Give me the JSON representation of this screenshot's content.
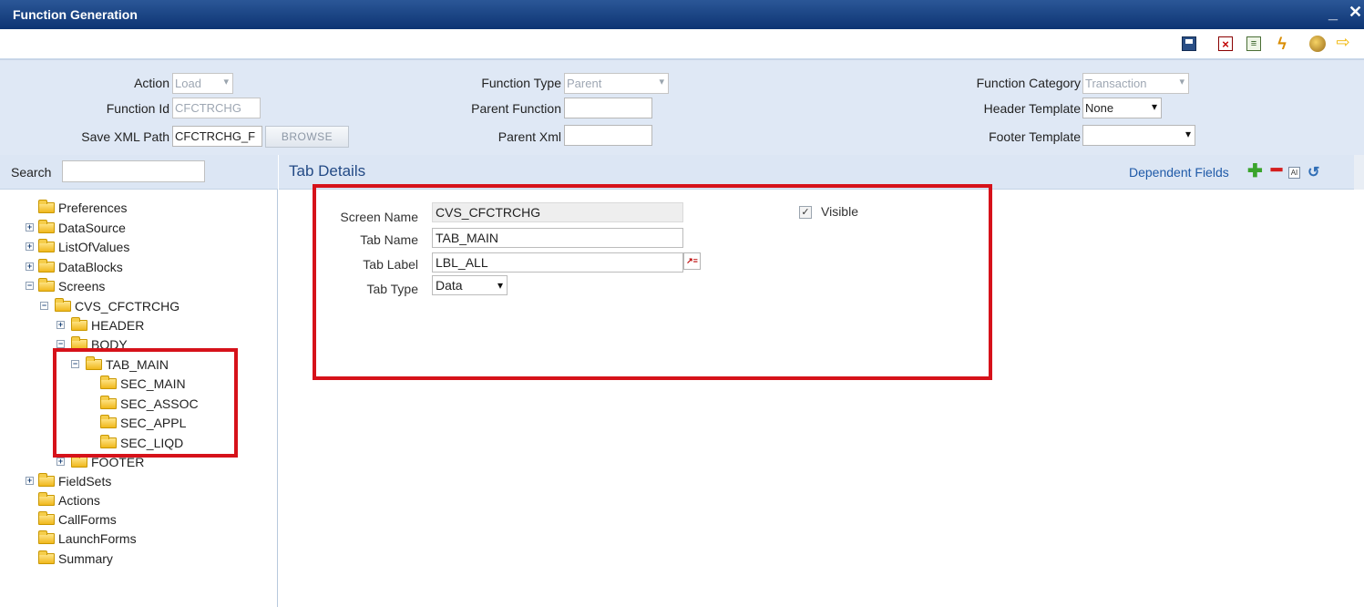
{
  "window": {
    "title": "Function Generation",
    "minimize_glyph": "_",
    "close_glyph": "✕"
  },
  "toolbar": {
    "icons": [
      "save-icon",
      "delete-icon",
      "list-icon",
      "generate-icon",
      "deploy-icon",
      "exit-icon"
    ]
  },
  "header": {
    "action": {
      "label": "Action",
      "value": "Load"
    },
    "function_id": {
      "label": "Function Id",
      "value": "CFCTRCHG"
    },
    "save_xml_path": {
      "label": "Save XML Path",
      "value": "CFCTRCHG_F",
      "browse_label": "BROWSE"
    },
    "function_type": {
      "label": "Function Type",
      "value": "Parent"
    },
    "parent_function": {
      "label": "Parent Function",
      "value": ""
    },
    "parent_xml": {
      "label": "Parent Xml",
      "value": ""
    },
    "function_category": {
      "label": "Function Category",
      "value": "Transaction"
    },
    "header_template": {
      "label": "Header Template",
      "value": "None"
    },
    "footer_template": {
      "label": "Footer Template",
      "value": ""
    }
  },
  "search": {
    "label": "Search",
    "value": ""
  },
  "tree": [
    {
      "label": "Preferences",
      "expander": ""
    },
    {
      "label": "DataSource",
      "expander": "+"
    },
    {
      "label": "ListOfValues",
      "expander": "+"
    },
    {
      "label": "DataBlocks",
      "expander": "+"
    },
    {
      "label": "Screens",
      "expander": "−"
    },
    {
      "label": "CVS_CFCTRCHG",
      "expander": "−"
    },
    {
      "label": "HEADER",
      "expander": "+"
    },
    {
      "label": "BODY",
      "expander": "−"
    },
    {
      "label": "TAB_MAIN",
      "expander": "−"
    },
    {
      "label": "SEC_MAIN",
      "expander": ""
    },
    {
      "label": "SEC_ASSOC",
      "expander": ""
    },
    {
      "label": "SEC_APPL",
      "expander": ""
    },
    {
      "label": "SEC_LIQD",
      "expander": ""
    },
    {
      "label": "FOOTER",
      "expander": "+"
    },
    {
      "label": "FieldSets",
      "expander": "+"
    },
    {
      "label": "Actions",
      "expander": ""
    },
    {
      "label": "CallForms",
      "expander": ""
    },
    {
      "label": "LaunchForms",
      "expander": ""
    },
    {
      "label": "Summary",
      "expander": ""
    }
  ],
  "details": {
    "title": "Tab Details",
    "dependent_fields_label": "Dependent Fields",
    "screen_name": {
      "label": "Screen Name",
      "value": "CVS_CFCTRCHG"
    },
    "tab_name": {
      "label": "Tab Name",
      "value": "TAB_MAIN"
    },
    "tab_label": {
      "label": "Tab Label",
      "value": "LBL_ALL"
    },
    "tab_type": {
      "label": "Tab Type",
      "value": "Data"
    },
    "visible": {
      "label": "Visible",
      "checked": true,
      "check_glyph": "✓"
    }
  },
  "colors": {
    "title_bar": "#1b4584",
    "header_bg": "#dfe8f5",
    "highlight_box": "#d6121a",
    "link": "#1f5aa8"
  }
}
